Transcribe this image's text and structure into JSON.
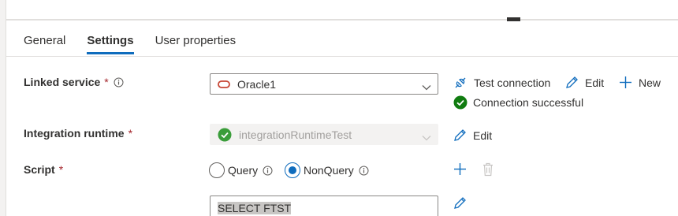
{
  "tabs": [
    {
      "label": "General",
      "active": false
    },
    {
      "label": "Settings",
      "active": true
    },
    {
      "label": "User properties",
      "active": false
    }
  ],
  "linked_service": {
    "label": "Linked service",
    "required_mark": "*",
    "value": "Oracle1",
    "icon": "oracle-icon",
    "actions": {
      "test_connection": "Test connection",
      "edit": "Edit",
      "new": "New"
    },
    "status": "Connection successful",
    "status_color": "#107c10"
  },
  "integration_runtime": {
    "label": "Integration runtime",
    "required_mark": "*",
    "value": "integrationRuntimeTest",
    "disabled": true,
    "edit": "Edit"
  },
  "script": {
    "label": "Script",
    "required_mark": "*",
    "options": [
      {
        "label": "Query",
        "checked": false
      },
      {
        "label": "NonQuery",
        "checked": true
      }
    ],
    "text": "SELECT FTST"
  },
  "colors": {
    "accent": "#0f6cbd",
    "required": "#a4262c",
    "success": "#107c10",
    "oracle": "#c74634"
  }
}
